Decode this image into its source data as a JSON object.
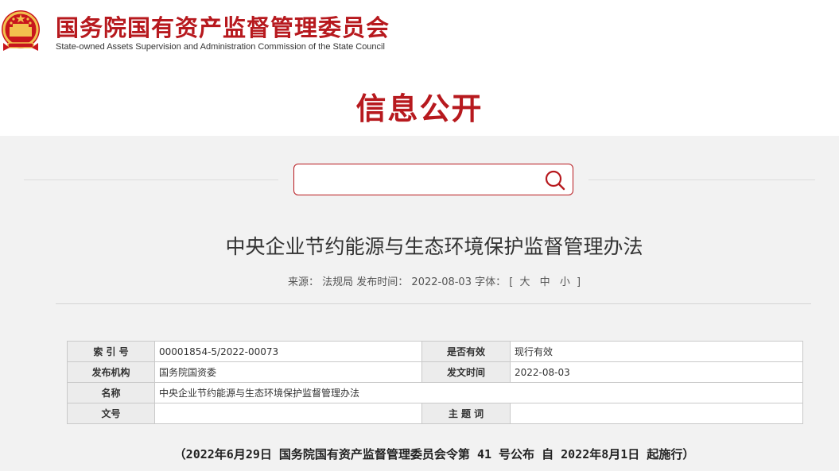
{
  "header": {
    "org_name_cn": "国务院国有资产监督管理委员会",
    "org_name_en": "State-owned Assets Supervision and Administration Commission of the State Council",
    "section_title": "信息公开"
  },
  "search": {
    "placeholder": "",
    "value": ""
  },
  "article": {
    "title": "中央企业节约能源与生态环境保护监督管理办法",
    "source_label": "来源：",
    "source": "法规局",
    "publish_label": "发布时间：",
    "publish_date": "2022-08-03",
    "font_label": "字体：",
    "bracket_open": "[",
    "size_large": "大",
    "size_medium": "中",
    "size_small": "小",
    "bracket_close": "]"
  },
  "info_table": {
    "index_label": "索 引 号",
    "index_value": "00001854-5/2022-00073",
    "valid_label": "是否有效",
    "valid_value": "现行有效",
    "issuer_label": "发布机构",
    "issuer_value": "国务院国资委",
    "issue_date_label": "发文时间",
    "issue_date_value": "2022-08-03",
    "name_label": "名称",
    "name_value": "中央企业节约能源与生态环境保护监督管理办法",
    "doc_no_label": "文号",
    "doc_no_value": "",
    "subject_label": "主 题 词",
    "subject_value": ""
  },
  "decree": "（2022年6月29日 国务院国有资产监督管理委员会令第 41 号公布 自 2022年8月1日 起施行）",
  "colors": {
    "brand_red": "#b7191e",
    "background_gray": "#f2f2f2"
  }
}
